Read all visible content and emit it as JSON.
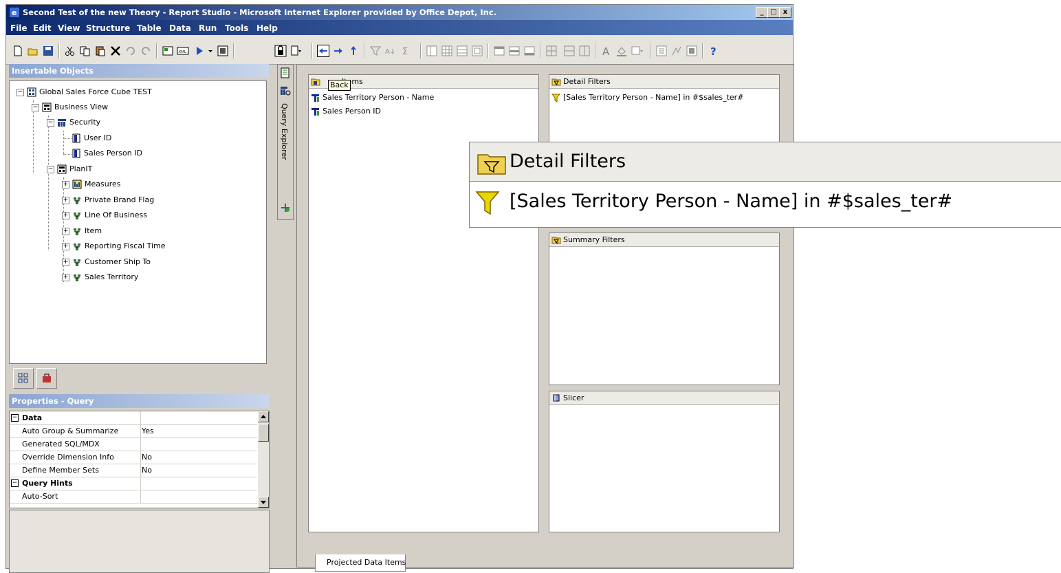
{
  "window": {
    "title": "Second Test of the new Theory - Report Studio - Microsoft Internet Explorer provided by Office Depot, Inc.",
    "buttons": {
      "minimize": "_",
      "maximize": "□",
      "close": "x"
    }
  },
  "menu": [
    "File",
    "Edit",
    "View",
    "Structure",
    "Table",
    "Data",
    "Run",
    "Tools",
    "Help"
  ],
  "insertable_objects": {
    "title": "Insertable Objects",
    "tree": [
      {
        "label": "Global Sales Force Cube TEST",
        "icon": "cube-icon"
      },
      {
        "label": "Business View",
        "icon": "folder-view-icon"
      },
      {
        "label": "Security",
        "icon": "dimension-table-icon"
      },
      {
        "label": "User ID",
        "icon": "measure-level-icon"
      },
      {
        "label": "Sales Person ID",
        "icon": "measure-level-icon"
      },
      {
        "label": "PlanIT",
        "icon": "folder-view-icon"
      },
      {
        "label": "Measures",
        "icon": "measures-folder-icon"
      },
      {
        "label": "Private Brand Flag",
        "icon": "dimension-icon"
      },
      {
        "label": "Line Of Business",
        "icon": "dimension-icon"
      },
      {
        "label": "Item",
        "icon": "dimension-icon"
      },
      {
        "label": "Reporting Fiscal Time",
        "icon": "dimension-icon"
      },
      {
        "label": "Customer Ship To",
        "icon": "dimension-icon"
      },
      {
        "label": "Sales Territory",
        "icon": "dimension-icon"
      }
    ]
  },
  "properties": {
    "title": "Properties -  Query",
    "rows": [
      {
        "name": "Data",
        "value": "",
        "group": true
      },
      {
        "name": "Auto Group & Summarize",
        "value": "Yes"
      },
      {
        "name": "Generated SQL/MDX",
        "value": ""
      },
      {
        "name": "Override Dimension Info",
        "value": "No"
      },
      {
        "name": "Define Member Sets",
        "value": "No"
      },
      {
        "name": "Query Hints",
        "value": "",
        "group": true
      },
      {
        "name": "Auto-Sort",
        "value": ""
      }
    ]
  },
  "query_explorer": {
    "label": "Query Explorer"
  },
  "data_items": {
    "title": "Items",
    "tooltip": "Back",
    "items": [
      "Sales Territory Person - Name",
      "Sales Person ID"
    ]
  },
  "detail_filters": {
    "title": "Detail Filters",
    "items": [
      "[Sales Territory Person - Name] in #$sales_ter#"
    ]
  },
  "summary_filters": {
    "title": "Summary Filters"
  },
  "slicer": {
    "title": "Slicer"
  },
  "bottom_tab": {
    "label": "Projected Data Items"
  },
  "zoom": {
    "title": "Detail Filters",
    "item": "[Sales Territory Person - Name] in #$sales_ter#"
  },
  "colors": {
    "title_bar": "#0a246a",
    "panel_header": "#8ba5d2",
    "chrome": "#d4d0c8",
    "filter_yellow": "#e8d800"
  }
}
